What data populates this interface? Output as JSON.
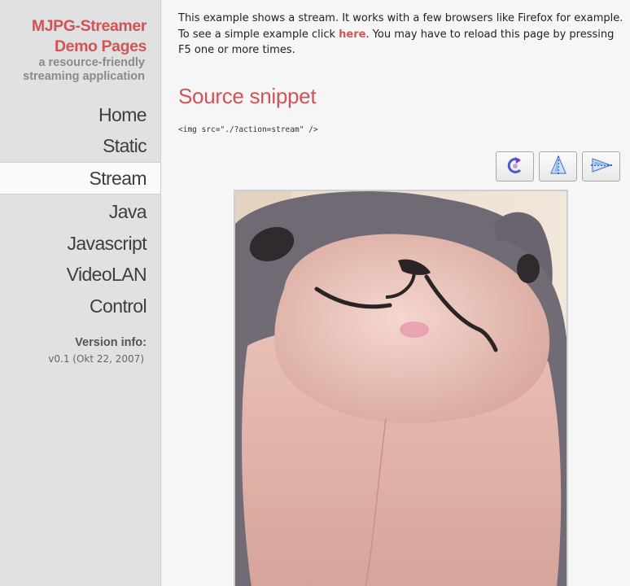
{
  "sidebar": {
    "title": "MJPG-Streamer Demo Pages",
    "subtitle": "a resource-friendly streaming application",
    "nav": [
      {
        "label": "Home"
      },
      {
        "label": "Static"
      },
      {
        "label": "Stream"
      },
      {
        "label": "Java"
      },
      {
        "label": "Javascript"
      },
      {
        "label": "VideoLAN"
      },
      {
        "label": "Control"
      }
    ],
    "active_nav": "Stream",
    "version_label": "Version info:",
    "version_value": "v0.1 (Okt 22, 2007)"
  },
  "main": {
    "intro_before_link": "This example shows a stream. It works with a few browsers like Firefox for example. To see a simple example click ",
    "intro_link": "here",
    "intro_after_link": ". You may have to reload this page by pressing F5 one or more times.",
    "section_title": "Source snippet",
    "code": "<img src=\"./?action=stream\" />",
    "toolbar": [
      {
        "icon": "rotate-icon"
      },
      {
        "icon": "flip-vertical-icon"
      },
      {
        "icon": "flip-horizontal-icon"
      }
    ]
  }
}
